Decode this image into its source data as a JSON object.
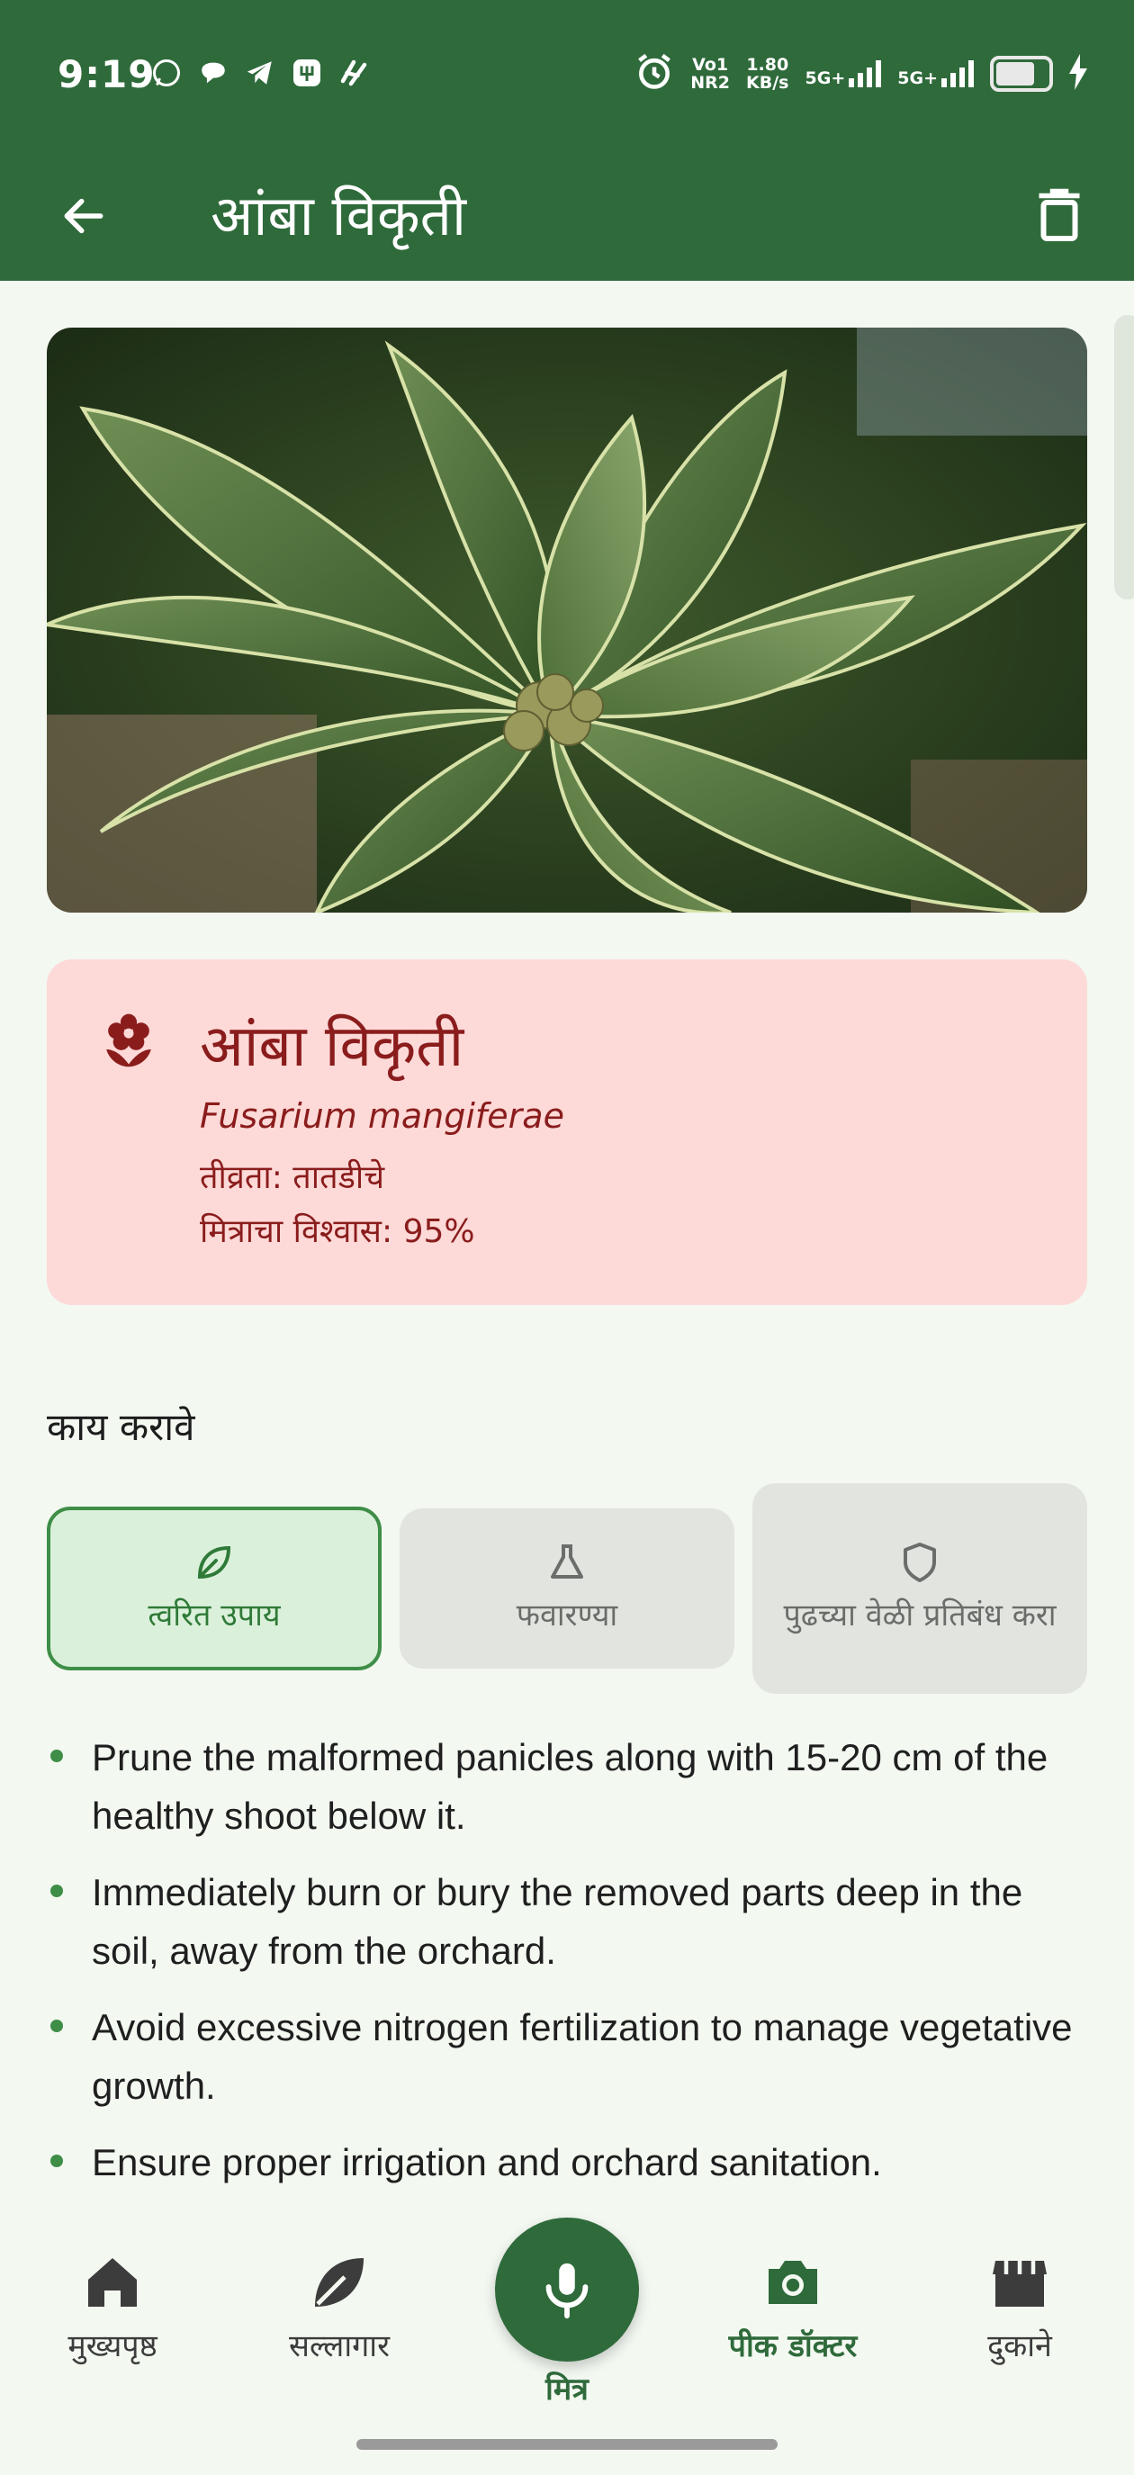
{
  "status_bar": {
    "time": "9:19",
    "network_line1": "Vo1",
    "network_line2": "NR2",
    "speed_value": "1.80",
    "speed_unit": "KB/s",
    "sim1": "5G+",
    "sim2": "5G+"
  },
  "app_bar": {
    "title": "आंबा विकृती"
  },
  "disease": {
    "name": "आंबा विकृती",
    "scientific_name": "Fusarium mangiferae",
    "severity": "तीव्रता: तातडीचे",
    "confidence": "मित्राचा विश्वास: 95%"
  },
  "section_heading": "काय करावे",
  "tabs": [
    {
      "label": "त्वरित उपाय",
      "icon": "leaf-icon",
      "selected": true
    },
    {
      "label": "फवारण्या",
      "icon": "flask-icon",
      "selected": false
    },
    {
      "label": "पुढच्या वेळी प्रतिबंध करा",
      "icon": "shield-icon",
      "selected": false
    }
  ],
  "steps": [
    "Prune the malformed panicles along with 15-20 cm of the healthy shoot below it.",
    "Immediately burn or bury the removed parts deep in the soil, away from the orchard.",
    "Avoid excessive nitrogen fertilization to manage vegetative growth.",
    "Ensure proper irrigation and orchard sanitation."
  ],
  "bottom_nav": {
    "home": "मुख्यपृष्ठ",
    "advisor": "सल्लागार",
    "mitra": "मित्र",
    "crop_doctor": "पीक डॉक्टर",
    "shops": "दुकाने"
  },
  "colors": {
    "primary": "#2f6a3b",
    "card_bg": "#fdd9d7",
    "card_text": "#8a1c1c",
    "background": "#f3f8f1"
  }
}
